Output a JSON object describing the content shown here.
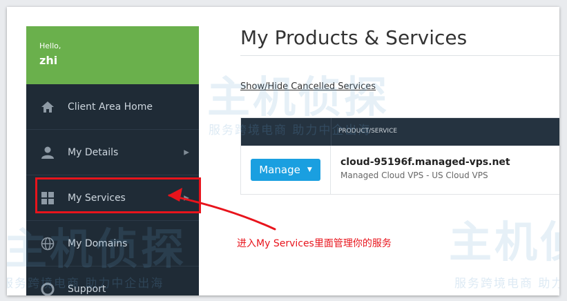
{
  "greeting": {
    "label": "Hello,",
    "name": "zhi"
  },
  "sidebar": {
    "items": [
      {
        "label": "Client Area Home",
        "icon": "home-icon"
      },
      {
        "label": "My Details",
        "icon": "user-icon"
      },
      {
        "label": "My Services",
        "icon": "grid-icon"
      },
      {
        "label": "My Domains",
        "icon": "globe-icon"
      },
      {
        "label": "Support",
        "icon": "support-icon"
      }
    ]
  },
  "main": {
    "title": "My Products & Services",
    "toggle_link": "Show/Hide Cancelled Services",
    "table": {
      "header": "PRODUCT/SERVICE",
      "rows": [
        {
          "action": "Manage",
          "domain": "cloud-95196f.managed-vps.net",
          "plan": "Managed Cloud VPS - US Cloud VPS"
        }
      ]
    }
  },
  "annotation": {
    "text": "进入My Services里面管理你的服务",
    "color": "#e8141c"
  },
  "watermark": {
    "brand": "主机侦探",
    "slogan": "服务跨境电商 助力中企出海"
  },
  "colors": {
    "accent_green": "#6ab04c",
    "sidebar_bg": "#1f2b36",
    "button_blue": "#1a9fe0",
    "annotation_red": "#e8141c"
  }
}
